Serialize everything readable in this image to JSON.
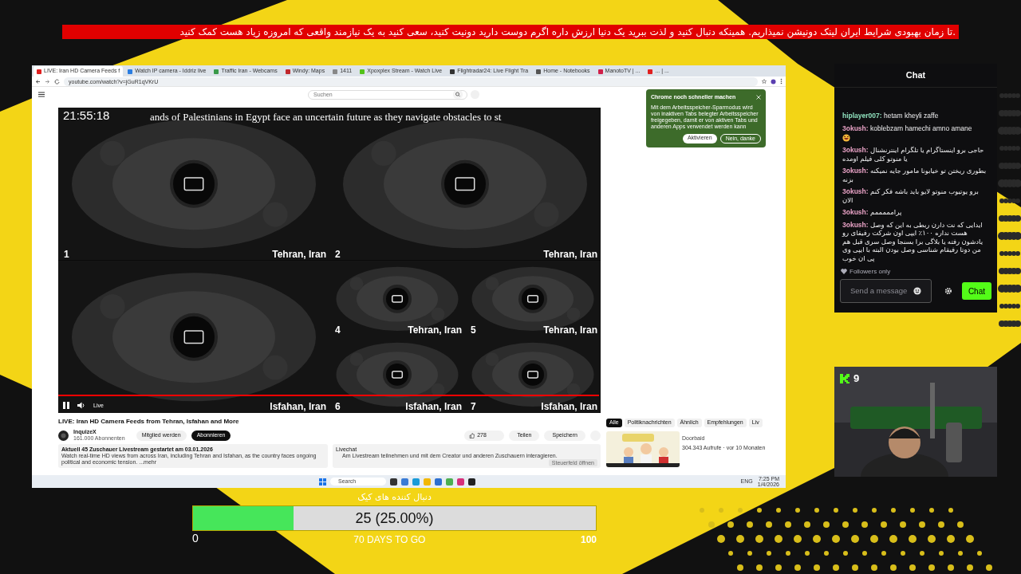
{
  "banner": {
    "text": ".تا زمان بهبودی شرایط ایران لینک دونیشن نمیذاریم. همینکه دنبال کنید و لذت ببرید یک دنیا ارزش داره اگرم دوست دارید دونیت کنید، سعی کنید به یک نیازمند واقعی که امروزه زیاد هست کمک کنید"
  },
  "browser": {
    "tabs": [
      {
        "title": "LIVE: Iran HD Camera Feeds f",
        "selected": true,
        "color": "#e02020"
      },
      {
        "title": "Watch IP camera - Iddriz live",
        "selected": false,
        "color": "#2a7de1"
      },
      {
        "title": "Traffic Iran - Webcams",
        "selected": false,
        "color": "#3a9a4a"
      },
      {
        "title": "Windy: Maps",
        "selected": false,
        "color": "#c0282d"
      },
      {
        "title": "1411",
        "selected": false,
        "color": "#888888"
      },
      {
        "title": "Xpoxplex Stream - Watch Live",
        "selected": false,
        "color": "#53c21a"
      },
      {
        "title": "Flightradar24: Live Flight Tra",
        "selected": false,
        "color": "#333333"
      },
      {
        "title": "Home - Notebooks",
        "selected": false,
        "color": "#555555"
      },
      {
        "title": "ManotoTV | ...",
        "selected": false,
        "color": "#d0204a"
      },
      {
        "title": "... | ...",
        "selected": false,
        "color": "#e02020"
      }
    ],
    "url": "youtube.com/watch?v=jGuR1qVKrU",
    "search_placeholder": "Suchen",
    "popup": {
      "title": "Chrome noch schneller machen",
      "body": "Mit dem Arbeitsspeicher-Sparmodus wird von inaktiven Tabs belegter Arbeitsspeicher freigegeben, damit er von aktiven Tabs und anderen Apps verwendet werden kann",
      "buttons": [
        "Aktivieren",
        "Nein, danke"
      ]
    },
    "video": {
      "clock": "21:55:18",
      "ticker": "ands of Palestinians in Egypt face an uncertain future as they navigate obstacles to st",
      "live_label": "Live",
      "level": 1,
      "cameras": [
        {
          "number": "1",
          "location": "Tehran, Iran"
        },
        {
          "number": "2",
          "location": "Tehran, Iran"
        },
        {
          "number": "4",
          "location": "Tehran, Iran"
        },
        {
          "number": "5",
          "location": "Tehran, Iran"
        },
        {
          "location": "Isfahan, Iran"
        },
        {
          "number": "6",
          "location": "Isfahan, Iran"
        },
        {
          "number": "7",
          "location": "Isfahan, Iran"
        }
      ]
    },
    "video_title": "LIVE: Iran HD Camera Feeds from Tehran, Isfahan and More",
    "channel": {
      "name": "InquizeX",
      "subscribers": "161.000 Abonnenten",
      "join": "Mitglied werden",
      "subscribe": "Abonnieren"
    },
    "actions": {
      "likes": "278",
      "share": "Teilen",
      "save": "Speichern"
    },
    "description": {
      "meta": "Aktuell 45 Zuschauer  Livestream gestartet am 03.01.2026",
      "text": "Watch real-time HD views from across Iran, including Tehran and Isfahan, as the country faces ongoing political and economic tension. ...mehr"
    },
    "livechat": {
      "title": "Livechat",
      "text": "Am Livestream teilnehmen und mit dem Creator und anderen Zuschauern interagieren.",
      "button": "Steuerfeld öffnen"
    },
    "chips": [
      {
        "label": "Alle",
        "selected": true
      },
      {
        "label": "Politiknachrichten",
        "selected": false
      },
      {
        "label": "Ähnlich",
        "selected": false
      },
      {
        "label": "Empfehlungen",
        "selected": false
      },
      {
        "label": "Liv",
        "selected": false
      }
    ],
    "recommendation": {
      "kind": "picture",
      "channel": "Doorbaid",
      "meta": "304.343 Aufrufe · vor 10 Monaten"
    }
  },
  "taskbar": {
    "search": "Search",
    "language": "ENG",
    "time": "7:25 PM",
    "date": "1/4/2026"
  },
  "chat": {
    "title": "Chat",
    "messages": [
      {
        "user": "hiplayer007:",
        "text": "hetam kheyli zaffe",
        "color": "#8fe0bd",
        "emoji": false
      },
      {
        "user": "3okush:",
        "text": "koblebzam hamechi amno amane",
        "color": "#e9a2c6",
        "emoji": true
      },
      {
        "user": "3okush:",
        "text": "حاجی برو اینستاگرام یا تلگرام اینترنشنال یا منوتو کلی فیلم اومده",
        "color": "#e9a2c6",
        "emoji": false
      },
      {
        "user": "3okush:",
        "text": "بطوری ریختن تو خیابونا مامور جایه نمیکنه بزنه",
        "color": "#e9a2c6",
        "emoji": false
      },
      {
        "user": "3okush:",
        "text": "برو یوتیوب منوتو لایو باید باشه فکر کنم الان",
        "color": "#e9a2c6",
        "emoji": false
      },
      {
        "user": "3okush:",
        "text": "پرامممممم",
        "color": "#e9a2c6",
        "emoji": false
      },
      {
        "user": "3okush:",
        "text": "ایدایی که نت دارن ربطی به این که وصل هست نداره ۱۰۰٪ ایپی اون شرکت رفیقای رو یادشون رفته یا بلاگی برا بسنجا وصل سری قبل هم من دوتا رفیقام شناسی وصل بودن البته با ایپی وی پی ان خوب",
        "color": "#e9a2c6",
        "emoji": false
      }
    ],
    "followers_only": "Followers only",
    "placeholder": "Send a message",
    "send_button": "Chat"
  },
  "webcam": {
    "viewers": "9"
  },
  "goal": {
    "title": "دنبال کننده های کیک",
    "level": 0.25,
    "reading": "25 (25.00%)",
    "min": "0",
    "max": "100",
    "days_left": "70 DAYS TO GO"
  }
}
